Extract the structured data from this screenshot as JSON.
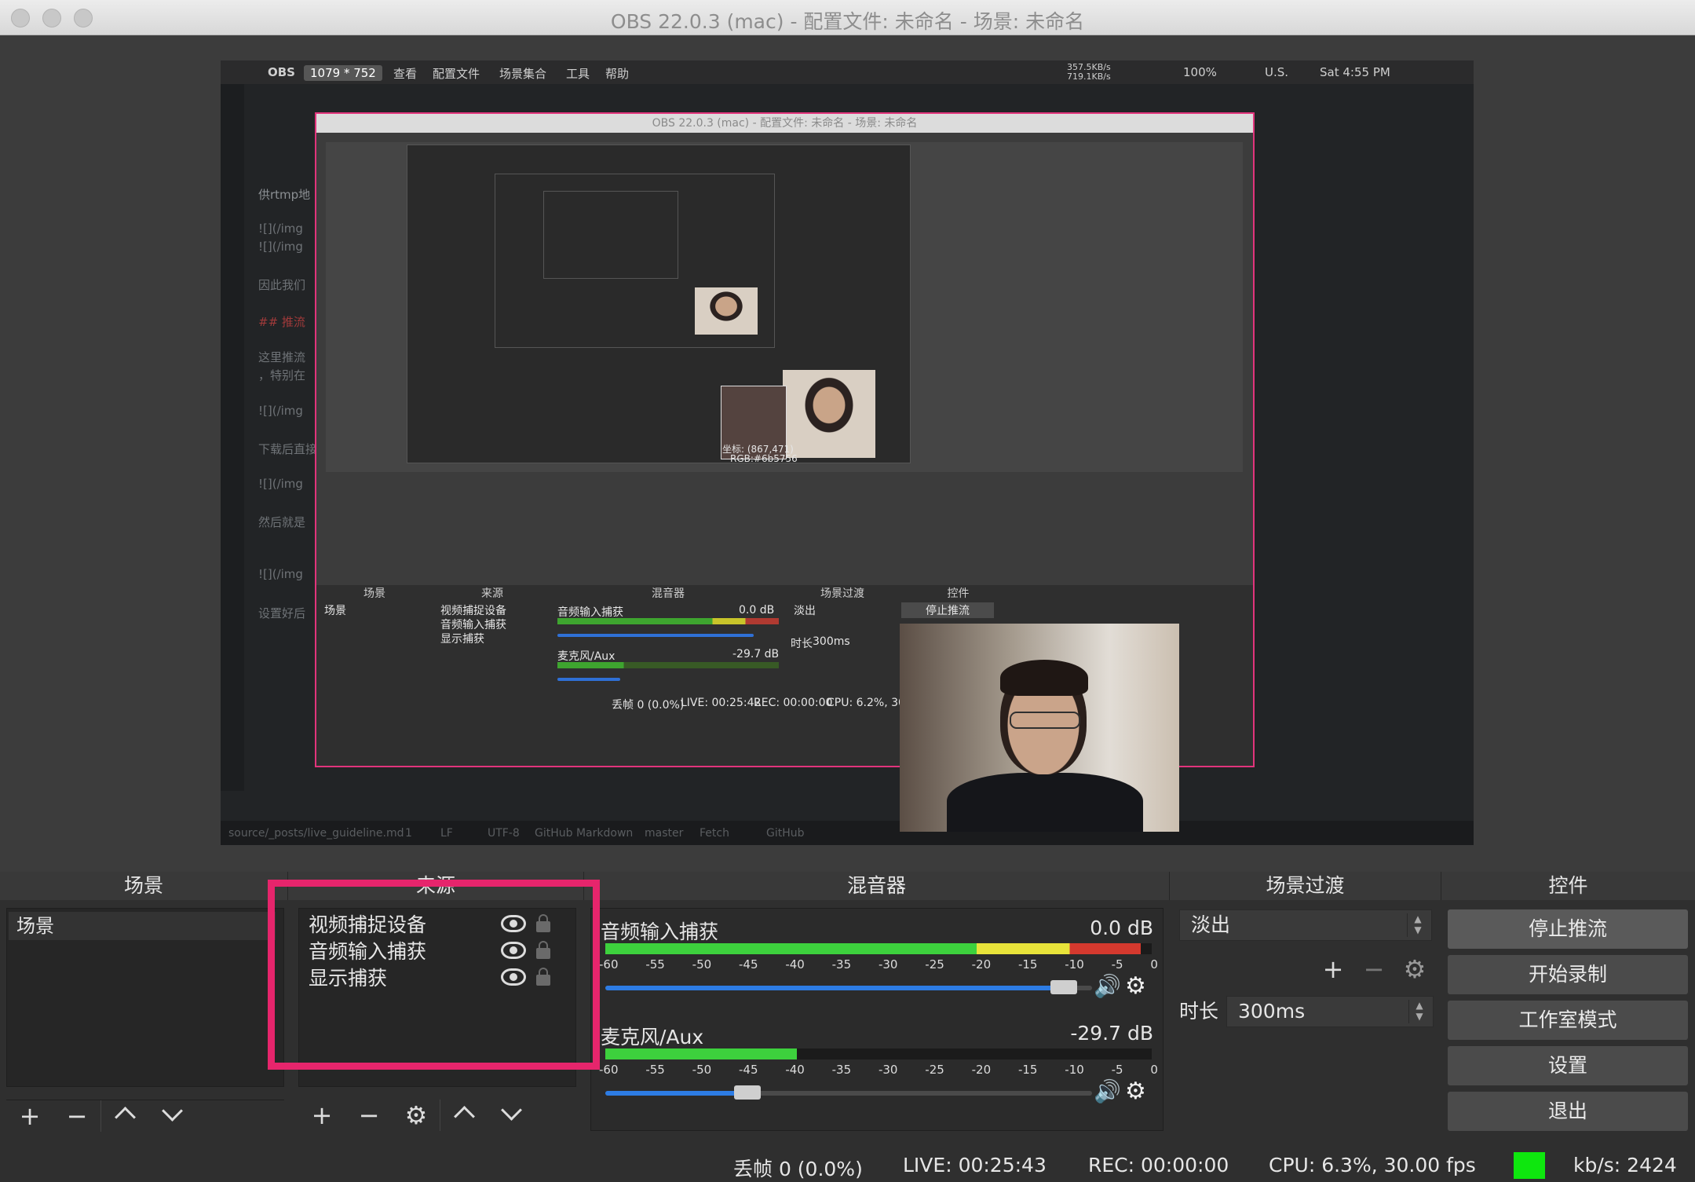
{
  "window": {
    "title": "OBS 22.0.3 (mac) - 配置文件: 未命名 - 场景: 未命名"
  },
  "preview": {
    "menubar": {
      "app": "OBS",
      "size_badge": "1079 * 752",
      "items": [
        "查看",
        "配置文件",
        "场景集合",
        "工具",
        "帮助"
      ],
      "net": "357.5KB/s 719.1KB/s",
      "battery": "100%",
      "locale": "U.S.",
      "clock": "Sat 4:55 PM"
    },
    "editor_lines": [
      "供rtmp地",
      "![](/img",
      "![](/img",
      "因此我们",
      "## 推流",
      "这里推流",
      "，特别在",
      "![](/img",
      "下载后直接",
      "![](/img",
      "然后就是",
      "![](/img",
      "设置好后"
    ],
    "editor_status": {
      "file": "source/_posts/live_guideline.md",
      "errors": "1",
      "eol": "LF",
      "encoding": "UTF-8",
      "grammar": "GitHub Markdown",
      "branch": "master",
      "fetch": "Fetch",
      "github": "GitHub"
    },
    "inner": {
      "title": "OBS 22.0.3 (mac) - 配置文件: 未命名 - 场景: 未命名",
      "headers": [
        "场景",
        "来源",
        "混音器",
        "场景过渡",
        "控件"
      ],
      "scene": "场景",
      "sources": [
        "视频捕捉设备",
        "音频输入捕获",
        "显示捕获"
      ],
      "mixer": [
        {
          "name": "音频输入捕获",
          "db": "0.0 dB"
        },
        {
          "name": "麦克风/Aux",
          "db": "-29.7 dB"
        }
      ],
      "transition": "淡出",
      "duration_label": "时长",
      "duration": "300ms",
      "stop_btn": "停止推流",
      "status": {
        "dropped": "丢帧 0 (0.0%)",
        "live": "LIVE: 00:25:42",
        "rec": "REC: 00:00:00",
        "cpu": "CPU: 6.2%, 30.00 f"
      },
      "pick": {
        "coord": "坐标: (867,471)",
        "rgb": "RGB:#6b5756"
      }
    }
  },
  "docks": {
    "headers": {
      "scenes": "场景",
      "sources": "来源",
      "mixer": "混音器",
      "transitions": "场景过渡",
      "controls": "控件"
    },
    "scenes": {
      "items": [
        "场景"
      ]
    },
    "sources": {
      "items": [
        "视频捕捉设备",
        "音频输入捕获",
        "显示捕获"
      ]
    },
    "mixer": {
      "ticks": [
        "-60",
        "-55",
        "-50",
        "-45",
        "-40",
        "-35",
        "-30",
        "-25",
        "-20",
        "-15",
        "-10",
        "-5",
        "0"
      ],
      "channels": [
        {
          "name": "音频输入捕获",
          "db": "0.0 dB",
          "level": 0.98,
          "fader": 0.97
        },
        {
          "name": "麦克风/Aux",
          "db": "-29.7 dB",
          "level": 0.35,
          "fader": 0.32
        }
      ]
    },
    "transitions": {
      "selected": "淡出",
      "duration_label": "时长",
      "duration": "300ms"
    },
    "controls": {
      "buttons": [
        "停止推流",
        "开始录制",
        "工作室模式",
        "设置",
        "退出"
      ]
    }
  },
  "status": {
    "dropped": "丢帧 0 (0.0%)",
    "live": "LIVE: 00:25:43",
    "rec": "REC: 00:00:00",
    "cpu": "CPU: 6.3%, 30.00 fps",
    "kbps": "kb/s: 2424",
    "indicator_color": "#0ee70e"
  },
  "colors": {
    "highlight": "#e6256c",
    "fader_blue": "#2d7ce4"
  }
}
